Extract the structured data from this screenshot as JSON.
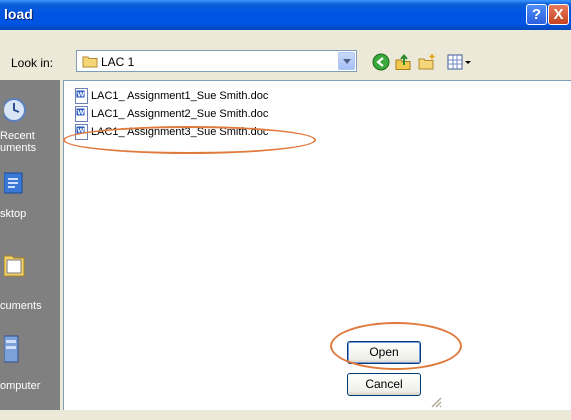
{
  "window": {
    "title": "load",
    "help_glyph": "?",
    "close_glyph": "X"
  },
  "lookin": {
    "label": "Look in:",
    "value": "LAC 1"
  },
  "places": [
    {
      "line1": "Recent",
      "line2": "uments",
      "icon": "recent-documents-icon"
    },
    {
      "line1": "sktop",
      "icon": "desktop-icon"
    },
    {
      "line1": "cuments",
      "icon": "my-documents-icon"
    },
    {
      "line1": "omputer",
      "icon": "my-computer-icon"
    }
  ],
  "files": [
    {
      "name": "LAC1_ Assignment1_Sue Smith.doc",
      "icon": "word-doc-icon"
    },
    {
      "name": "LAC1_ Assignment2_Sue Smith.doc",
      "icon": "word-doc-icon"
    },
    {
      "name": "LAC1_ Assignment3_Sue Smith.doc",
      "icon": "word-doc-icon"
    }
  ],
  "buttons": {
    "open": "Open",
    "cancel": "Cancel"
  },
  "colors": {
    "titlebar": "#0054e3",
    "annotation": "#e07a3c",
    "places_bg": "#808080",
    "dialog_bg": "#ece9d8"
  }
}
